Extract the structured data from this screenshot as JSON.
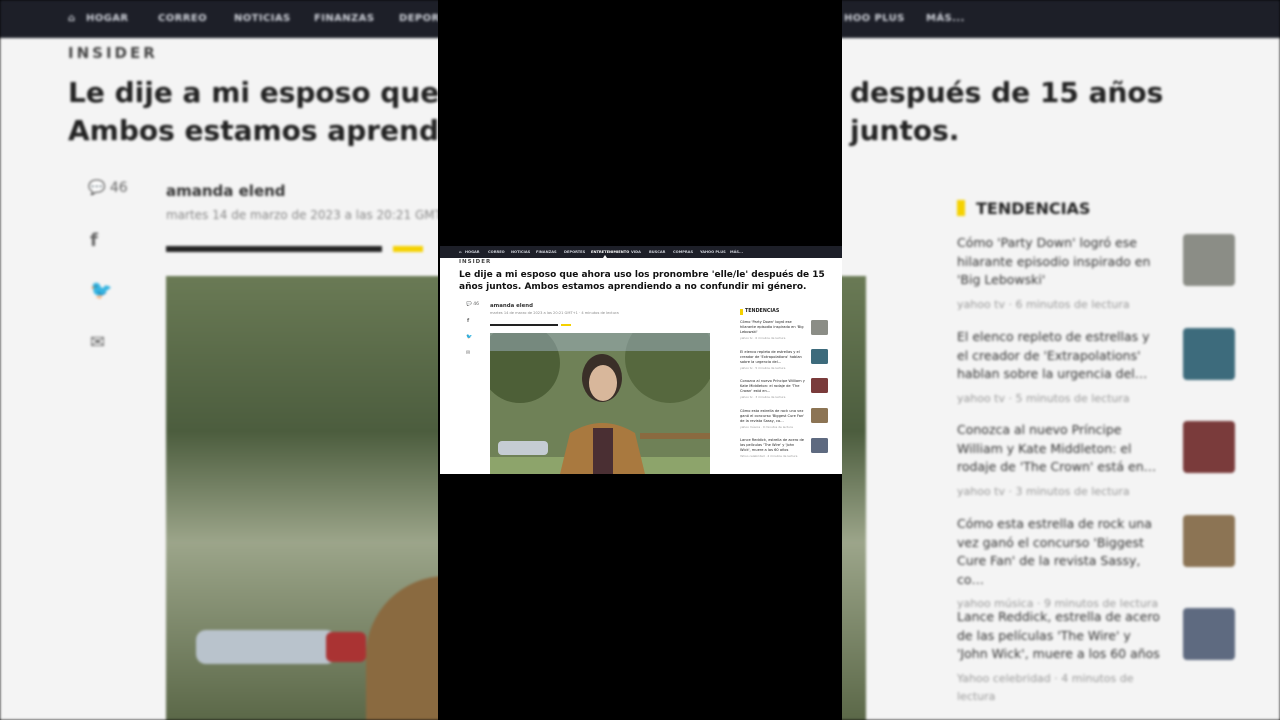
{
  "colors": {
    "nav_bg": "#1d1f28",
    "accent": "#f5d100",
    "frame_bg": "#000000"
  },
  "nav": {
    "items": [
      "HOGAR",
      "CORREO",
      "NOTICIAS",
      "FINANZAS",
      "DEPORTES",
      "ENTRETENIMIENTO",
      "VIDA",
      "BUSCAR",
      "COMPRAS",
      "YAHOO PLUS",
      "MÁS..."
    ],
    "active": "ENTRETENIMIENTO",
    "bg_visible": [
      "HOGAR",
      "CORREO",
      "NOTICIAS",
      "FINANZAS",
      "DEPORT",
      "HOO PLUS",
      "MÁS..."
    ]
  },
  "article": {
    "brand": "INSIDER",
    "title": "Le dije a mi esposo que ahora uso los pronombre 'elle/le' después de 15 años juntos. Ambos estamos aprendiendo a no confundir mi género.",
    "bg_title_left_1": "Le dije a mi esposo que aho",
    "bg_title_left_2": "Ambos estamos aprendien",
    "bg_title_right_1": "después de 15 años juntos.",
    "comments": "46",
    "author": "amanda elend",
    "date": "martes 14 de marzo de 2023 a las 20:21 GMT+1",
    "bg_date": "martes 14 de marzo de 2023 a las 20:21 GMT+1",
    "read_time": "4 minutos de lectura",
    "social_icons": [
      "facebook-icon",
      "twitter-icon",
      "mail-icon"
    ]
  },
  "trends": {
    "heading": "TENDENCIAS",
    "items": [
      {
        "title": "Cómo 'Party Down' logró ese hilarante episodio inspirado en 'Big Lebowski'",
        "source": "yahoo tv",
        "time": "6 minutos de lectura"
      },
      {
        "title": "El elenco repleto de estrellas y el creador de 'Extrapolations' hablan sobre la urgencia del…",
        "source": "yahoo tv",
        "time": "5 minutos de lectura"
      },
      {
        "title": "Conozca al nuevo Príncipe William y Kate Middleton: el rodaje de 'The Crown' está en…",
        "source": "yahoo tv",
        "time": "3 minutos de lectura"
      },
      {
        "title": "Cómo esta estrella de rock una vez ganó el concurso 'Biggest Cure Fan' de la revista Sassy, co…",
        "source": "yahoo música",
        "time": "9 minutos de lectura"
      },
      {
        "title": "Lance Reddick, estrella de acero de las películas 'The Wire' y 'John Wick', muere a los 60 años",
        "source": "Yahoo celebridad",
        "time": "4 minutos de lectura"
      }
    ]
  }
}
